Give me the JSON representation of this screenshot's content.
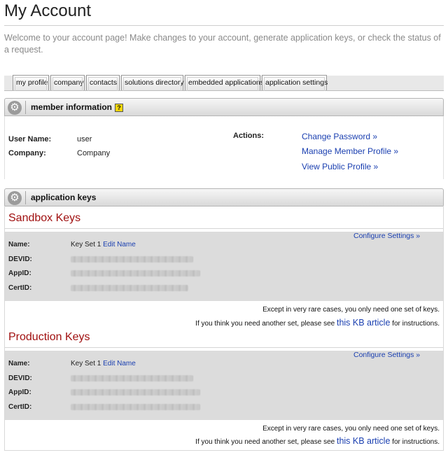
{
  "page": {
    "title": "My Account",
    "welcome": "Welcome to your account page! Make changes to your account, generate application keys, or check the status of a request."
  },
  "tabs": [
    {
      "label": "my profile"
    },
    {
      "label": "company"
    },
    {
      "label": "contacts"
    },
    {
      "label": "solutions directory"
    },
    {
      "label": "embedded applications"
    },
    {
      "label": "application settings"
    }
  ],
  "member_section": {
    "title": "member information",
    "help_icon": "?",
    "user_name_label": "User Name:",
    "user_name_value": "user",
    "company_label": "Company:",
    "company_value": "Company",
    "actions_label": "Actions:",
    "actions": [
      {
        "label": "Change Password »"
      },
      {
        "label": "Manage Member Profile »"
      },
      {
        "label": "View Public Profile »"
      }
    ]
  },
  "keys_section": {
    "title": "application keys",
    "sandbox": {
      "heading": "Sandbox Keys",
      "configure": "Configure Settings »",
      "name_label": "Name:",
      "name_value": "Key Set 1",
      "edit_name": "Edit Name",
      "devid_label": "DEVID:",
      "appid_label": "AppID:",
      "certid_label": "CertID:",
      "note_line1": "Except in very rare cases, you only need one set of keys.",
      "note_line2_pre": "If you think you need another set, please see",
      "note_link": "this KB article",
      "note_line2_post": "for instructions."
    },
    "production": {
      "heading": "Production Keys",
      "configure": "Configure Settings »",
      "name_label": "Name:",
      "name_value": "Key Set 1",
      "edit_name": "Edit Name",
      "devid_label": "DEVID:",
      "appid_label": "AppID:",
      "certid_label": "CertID:",
      "note_line1": "Except in very rare cases, you only need one set of keys.",
      "note_line2_pre": "If you think you need another set, please see",
      "note_link": "this KB article",
      "note_line2_post": "for instructions."
    }
  },
  "icons": {
    "gear": "gear-icon",
    "help": "help-icon"
  },
  "colors": {
    "link": "#1a3fb0",
    "keys_heading": "#a01010",
    "help_icon": "#f5d70b"
  }
}
